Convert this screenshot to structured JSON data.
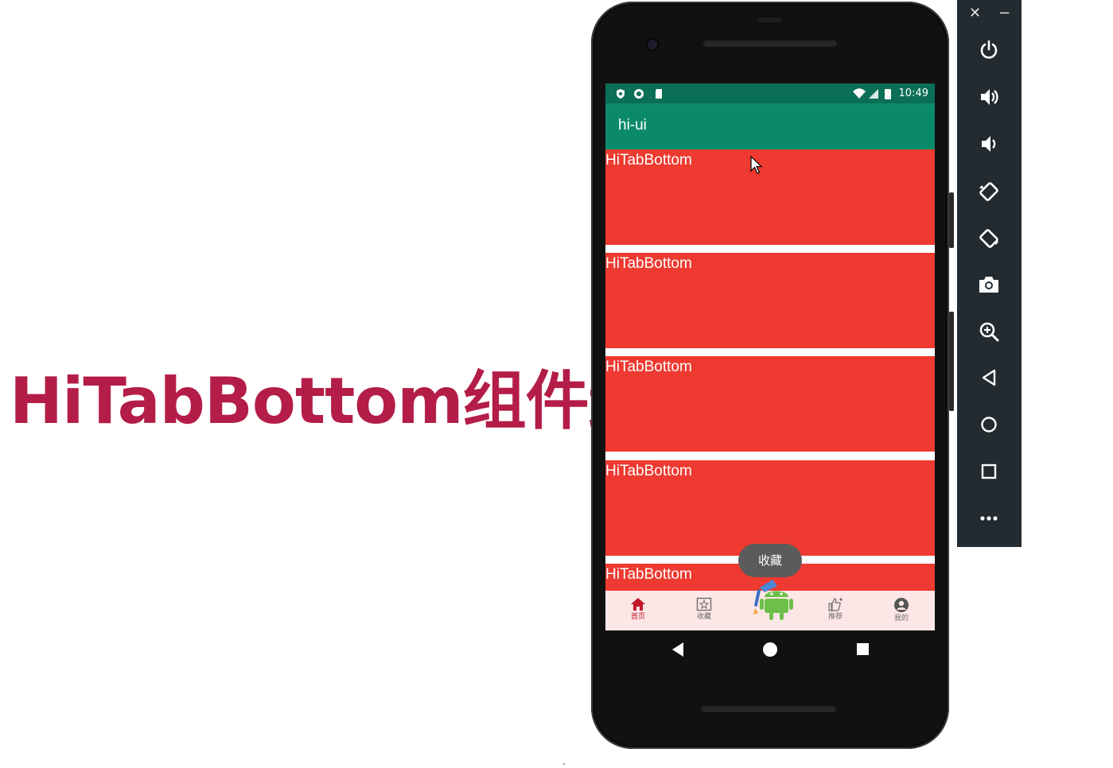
{
  "slide": {
    "title": "HiTabBottom组件封"
  },
  "phone": {
    "status_bar": {
      "time": "10:49"
    },
    "app_bar": {
      "title": "hi-ui"
    },
    "list_items": [
      {
        "label": "HiTabBottom"
      },
      {
        "label": "HiTabBottom"
      },
      {
        "label": "HiTabBottom"
      },
      {
        "label": "HiTabBottom"
      },
      {
        "label": "HiTabBottom"
      }
    ],
    "toast": "收藏",
    "tabs": [
      {
        "label": "首页",
        "icon": "home-icon",
        "active": true
      },
      {
        "label": "收藏",
        "icon": "favorite-icon",
        "active": false
      },
      {
        "label": "",
        "icon": "android-mascot-icon",
        "active": false
      },
      {
        "label": "推荐",
        "icon": "thumbs-up-icon",
        "active": false
      },
      {
        "label": "我的",
        "icon": "profile-icon",
        "active": false
      }
    ]
  },
  "emulator_toolbar": {
    "close": "✕",
    "minimize": "−",
    "buttons": [
      "power-icon",
      "volume-up-icon",
      "volume-down-icon",
      "rotate-left-icon",
      "rotate-right-icon",
      "camera-icon",
      "zoom-icon",
      "back-icon",
      "home-icon",
      "overview-icon",
      "more-icon"
    ]
  },
  "colors": {
    "title": "#b41d48",
    "status_bar": "#0b6e56",
    "app_bar": "#0b8a6a",
    "card": "#ee3a30",
    "tab_bar": "#fde6e6",
    "tab_active": "#c2182b",
    "emulator_panel": "#232b30"
  }
}
